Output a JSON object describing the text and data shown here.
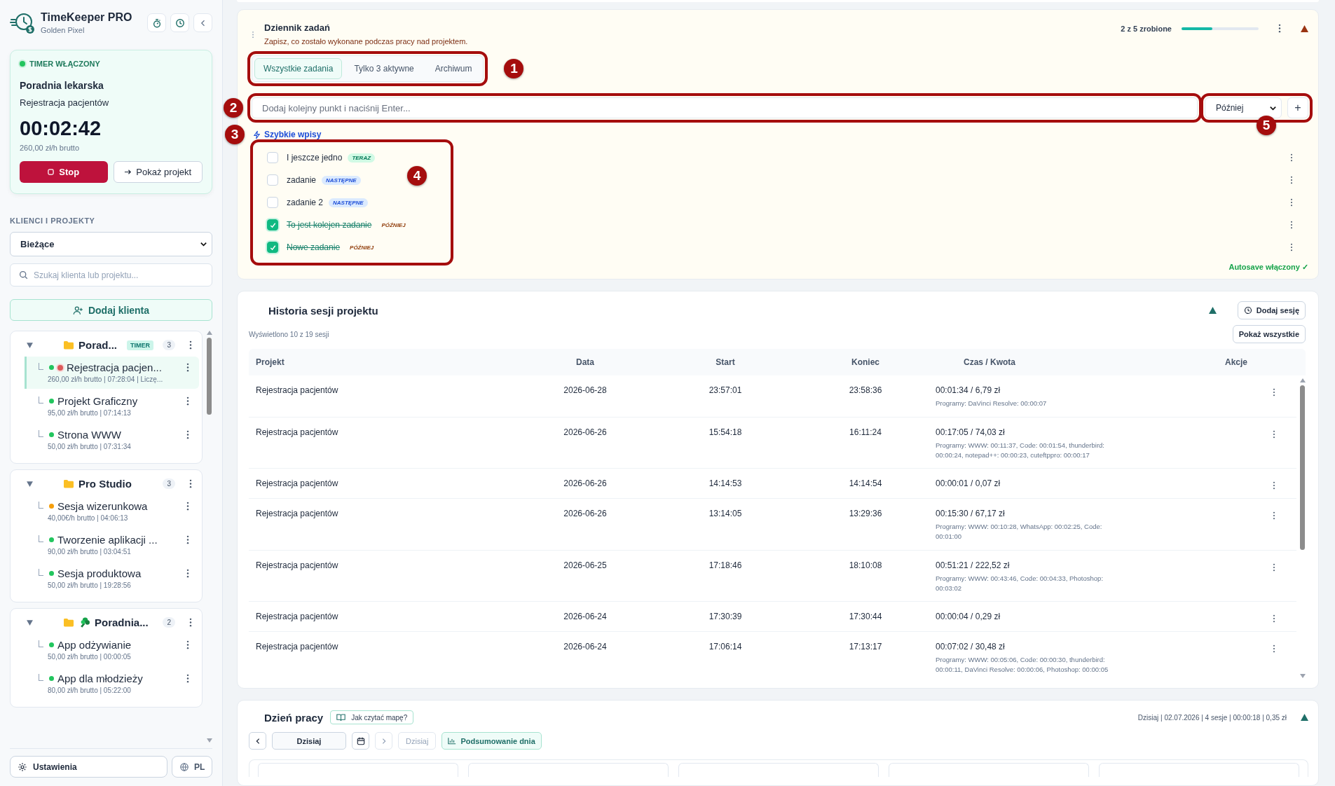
{
  "app": {
    "name": "TimeKeeper PRO",
    "subtitle": "Golden Pixel"
  },
  "timer": {
    "status": "TIMER WŁĄCZONY",
    "client": "Poradnia lekarska",
    "project": "Rejestracja pacjentów",
    "time": "00:02:42",
    "rate": "260,00 zł/h brutto",
    "stop": "Stop",
    "show": "Pokaż projekt"
  },
  "sidebar": {
    "section_title": "KLIENCI I PROJEKTY",
    "filter_value": "Bieżące",
    "search_placeholder": "Szukaj klienta lub projektu...",
    "add_client": "Dodaj klienta",
    "clients": [
      {
        "name": "Porad...",
        "badge": "TIMER",
        "count": "3",
        "expanded": true,
        "projects": [
          {
            "name": "Rejestracja pacjen...",
            "meta": "260,00 zł/h brutto | 07:28:04 | Liczę...",
            "color": "#22c55e",
            "selected": true,
            "recording": true
          },
          {
            "name": "Projekt Graficzny",
            "meta": "95,00 zł/h brutto | 07:14:13",
            "color": "#22c55e",
            "selected": false
          },
          {
            "name": "Strona WWW",
            "meta": "50,00 zł/h brutto | 07:31:34",
            "color": "#22c55e",
            "selected": false
          }
        ]
      },
      {
        "name": "Pro Studio",
        "count": "3",
        "expanded": true,
        "projects": [
          {
            "name": "Sesja wizerunkowa",
            "meta": "40,00€/h brutto | 04:06:13",
            "color": "#f59e0b",
            "selected": false
          },
          {
            "name": "Tworzenie aplikacji ...",
            "meta": "90,00 zł/h brutto | 03:04:51",
            "color": "#22c55e",
            "selected": false
          },
          {
            "name": "Sesja produktowa",
            "meta": "50,00 zł/h brutto | 19:28:56",
            "color": "#22c55e",
            "selected": false
          }
        ]
      },
      {
        "name": "Poradnia...",
        "count": "2",
        "expanded": true,
        "projects": [
          {
            "name": "App odżywianie",
            "meta": "50,00 zł/h brutto | 00:00:05",
            "color": "#22c55e",
            "selected": false
          },
          {
            "name": "App dla młodzieży",
            "meta": "80,00 zł/h brutto | 05:22:00",
            "color": "#22c55e",
            "selected": false
          }
        ]
      }
    ],
    "settings": "Ustawienia",
    "language": "PL"
  },
  "tasks": {
    "title": "Dziennik zadań",
    "subtitle": "Zapisz, co zostało wykonane podczas pracy nad projektem.",
    "progress_text": "2 z 5 zrobione",
    "level": 0.4,
    "tabs": [
      {
        "label": "Wszystkie zadania",
        "selected": true
      },
      {
        "label": "Tylko 3 aktywne",
        "selected": false
      },
      {
        "label": "Archiwum",
        "selected": false
      }
    ],
    "input_placeholder": "Dodaj kolejny punkt i naciśnij Enter...",
    "priority_value": "Później",
    "add": "+",
    "quick_entries": "Szybkie wpisy",
    "items": [
      {
        "label": "I jeszcze jedno",
        "done": false,
        "tag": {
          "text": "TERAZ",
          "kind": "now"
        }
      },
      {
        "label": "zadanie",
        "done": false,
        "tag": {
          "text": "NASTĘPNE",
          "kind": "next"
        }
      },
      {
        "label": "zadanie 2",
        "done": false,
        "tag": {
          "text": "NASTĘPNE",
          "kind": "next"
        }
      },
      {
        "label": "To jest kolejen zadanie",
        "done": true,
        "tag": {
          "text": "PÓŹNIEJ",
          "kind": "later"
        }
      },
      {
        "label": "Nowe zadanie",
        "done": true,
        "tag": {
          "text": "PÓŹNIEJ",
          "kind": "later"
        }
      }
    ],
    "autosave": "Autosave włączony ✓"
  },
  "history": {
    "title": "Historia sesji projektu",
    "add_session": "Dodaj sesję",
    "shown": "Wyświetlono 10 z 19 sesji",
    "show_all": "Pokaż wszystkie",
    "columns": [
      "Projekt",
      "Data",
      "Start",
      "Koniec",
      "Czas / Kwota",
      "Akcje"
    ],
    "rows": [
      {
        "project": "Rejestracja pacjentów",
        "date": "2026-06-28",
        "start": "23:57:01",
        "end": "23:58:36",
        "amount": "00:01:34 / 6,79 zł",
        "programs": "Programy: DaVinci Resolve: 00:00:07"
      },
      {
        "project": "Rejestracja pacjentów",
        "date": "2026-06-26",
        "start": "15:54:18",
        "end": "16:11:24",
        "amount": "00:17:05 / 74,03 zł",
        "programs": "Programy: WWW: 00:11:37, Code: 00:01:54, thunderbird: 00:00:24, notepad++: 00:00:23, cuteftppro: 00:00:17"
      },
      {
        "project": "Rejestracja pacjentów",
        "date": "2026-06-26",
        "start": "14:14:53",
        "end": "14:14:54",
        "amount": "00:00:01 / 0,07 zł"
      },
      {
        "project": "Rejestracja pacjentów",
        "date": "2026-06-26",
        "start": "13:14:05",
        "end": "13:29:36",
        "amount": "00:15:30 / 67,17 zł",
        "programs": "Programy: WWW: 00:10:28, WhatsApp: 00:02:25, Code: 00:01:00"
      },
      {
        "project": "Rejestracja pacjentów",
        "date": "2026-06-25",
        "start": "17:18:46",
        "end": "18:10:08",
        "amount": "00:51:21 / 222,52 zł",
        "programs": "Programy: WWW: 00:43:46, Code: 00:04:33, Photoshop: 00:03:02"
      },
      {
        "project": "Rejestracja pacjentów",
        "date": "2026-06-24",
        "start": "17:30:39",
        "end": "17:30:44",
        "amount": "00:00:04 / 0,29 zł"
      },
      {
        "project": "Rejestracja pacjentów",
        "date": "2026-06-24",
        "start": "17:06:14",
        "end": "17:13:17",
        "amount": "00:07:02 / 30,48 zł",
        "programs": "Programy: WWW: 00:05:06, Code: 00:00:30, thunderbird: 00:00:11, DaVinci Resolve: 00:00:06, Photoshop: 00:00:05"
      }
    ]
  },
  "day": {
    "title": "Dzień pracy",
    "help": "Jak czytać mapę?",
    "summary": "Dzisiaj | 02.07.2026 | 4 sesje | 00:00:18 | 0,35 zł",
    "date_button": "Dzisiaj",
    "today_button": "Dzisiaj",
    "day_summary": "Podsumowanie dnia"
  },
  "callouts": [
    "1",
    "2",
    "3",
    "4",
    "5"
  ]
}
